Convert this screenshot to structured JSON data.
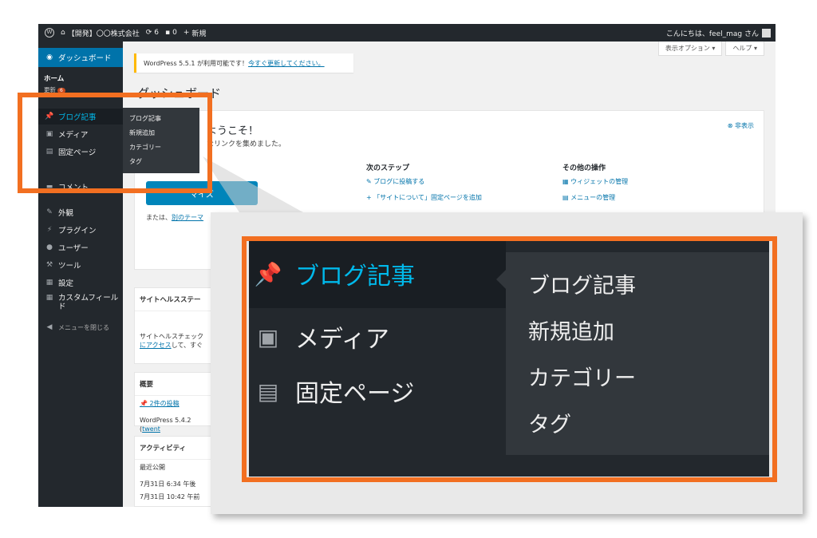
{
  "adminbar": {
    "site_name": "【開発】〇〇株式会社",
    "updates_count": "6",
    "comments_count": "0",
    "new_label": "新規",
    "greeting": "こんにちは、feel_mag さん"
  },
  "sidebar": {
    "dashboard": "ダッシュボード",
    "home": "ホーム",
    "updates": "更新",
    "updates_badge": "6",
    "items": [
      {
        "label": "ブログ記事"
      },
      {
        "label": "メディア"
      },
      {
        "label": "固定ページ"
      },
      {
        "label": "コメント"
      },
      {
        "label": "外観"
      },
      {
        "label": "プラグイン"
      },
      {
        "label": "ユーザー"
      },
      {
        "label": "ツール"
      },
      {
        "label": "設定"
      },
      {
        "label": "カスタムフィールド"
      },
      {
        "label": "メニューを閉じる"
      }
    ],
    "flyout": [
      "ブログ記事",
      "新規追加",
      "カテゴリー",
      "タグ"
    ]
  },
  "header": {
    "screen_options": "表示オプション ▾",
    "help": "ヘルプ ▾"
  },
  "notice": {
    "text": "WordPress 5.5.1 が利用可能です！",
    "link": "今すぐ更新してください。"
  },
  "page": {
    "title": "ダッシュボード"
  },
  "welcome": {
    "title": "ようこそ！",
    "subtitle": "なリンクを集めました。",
    "hide": "非表示",
    "customize_button": "マイズ",
    "or_text": "または、",
    "or_link": "別のテーマ",
    "next_steps": {
      "heading": "次のステップ",
      "links": [
        "ブログに投稿する",
        "「サイトについて」固定ページを追加"
      ]
    },
    "other_actions": {
      "heading": "その他の操作",
      "links": [
        "ウィジェットの管理",
        "メニューの管理"
      ]
    }
  },
  "boxes": {
    "health": {
      "title": "サイトヘルスステー",
      "text": "サイトヘルスチェック",
      "link": "にアクセス",
      "text2": "して、すぐ"
    },
    "glance": {
      "title": "概要",
      "posts": "2件の投稿",
      "version": "WordPress 5.4.2 (",
      "theme": "twent"
    },
    "activity": {
      "title": "アクティビティ",
      "recent": "最近公開",
      "date1": "7月31日 6:34 午後",
      "date2": "7月31日 10:42 午前"
    }
  },
  "zoom": {
    "items": [
      "ブログ記事",
      "メディア",
      "固定ページ"
    ],
    "flyout": [
      "ブログ記事",
      "新規追加",
      "カテゴリー",
      "タグ"
    ]
  },
  "colors": {
    "highlight": "#f26f21",
    "sidebar_bg": "#23282d",
    "active_text": "#00b9eb",
    "primary_button": "#0085ba"
  }
}
